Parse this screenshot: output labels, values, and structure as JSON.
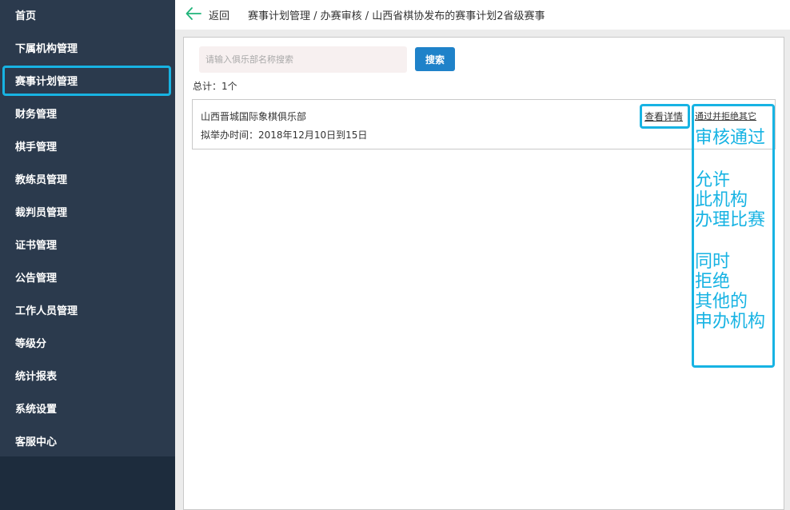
{
  "sidebar": {
    "items": [
      {
        "label": "首页"
      },
      {
        "label": "下属机构管理"
      },
      {
        "label": "赛事计划管理"
      },
      {
        "label": "财务管理"
      },
      {
        "label": "棋手管理"
      },
      {
        "label": "教练员管理"
      },
      {
        "label": "裁判员管理"
      },
      {
        "label": "证书管理"
      },
      {
        "label": "公告管理"
      },
      {
        "label": "工作人员管理"
      },
      {
        "label": "等级分"
      },
      {
        "label": "统计报表"
      },
      {
        "label": "系统设置"
      },
      {
        "label": "客服中心"
      }
    ],
    "active_index": 2
  },
  "header": {
    "back_icon": "arrow-left-icon",
    "back_label": "返回",
    "breadcrumb": "赛事计划管理 / 办赛审核 / 山西省棋协发布的赛事计划2省级赛事"
  },
  "search": {
    "placeholder": "请输入俱乐部名称搜索",
    "value": "",
    "button_label": "搜索"
  },
  "summary": {
    "total_text": "总计：1个"
  },
  "records": [
    {
      "name": "山西晋城国际象棋俱乐部",
      "date_label": "拟举办时间：",
      "date_value": "2018年12月10日到15日",
      "detail_link": "查看详情",
      "approve_link": "通过并拒绝其它"
    }
  ],
  "annotation": {
    "lines": [
      "审核通过",
      "",
      "允许",
      "此机构",
      "办理比赛",
      "",
      "同时",
      "拒绝",
      "其他的",
      "申办机构"
    ]
  },
  "colors": {
    "sidebar_bg": "#2b3a4d",
    "accent": "#17b3e3",
    "primary_button": "#1f82c9",
    "back_arrow": "#20b47a"
  }
}
